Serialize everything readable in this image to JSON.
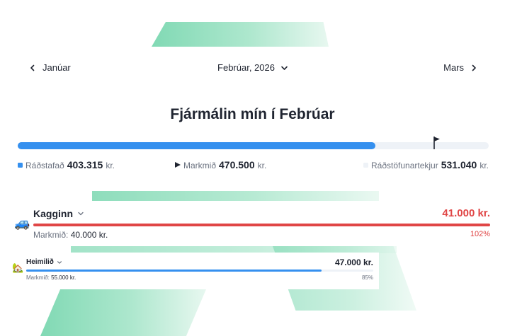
{
  "nav": {
    "prev_label": "Janúar",
    "current_label": "Febrúar, 2026",
    "next_label": "Mars"
  },
  "page_title": "Fjármálin mín í Febrúar",
  "overview": {
    "allocated_fraction": 0.76,
    "allocated": {
      "label": "Ráðstafað",
      "value": "403.315",
      "unit": "kr.",
      "color": "#3590ef"
    },
    "goal": {
      "label": "Markmið",
      "value": "470.500",
      "unit": "kr."
    },
    "income": {
      "label": "Ráðstöfunartekjur",
      "value": "531.040",
      "unit": "kr.",
      "color": "#eef2f7"
    }
  },
  "categories": [
    {
      "name": "Kagginn",
      "icon": "car-icon",
      "amount": "41.000 kr.",
      "goal_label": "Markmið:",
      "goal_value": "40.000 kr.",
      "percent": "102%",
      "fill_fraction": 1.0,
      "color": "#e04646"
    },
    {
      "name": "Heimilið",
      "icon": "house-icon",
      "amount": "47.000 kr.",
      "goal_label": "Markmið:",
      "goal_value": "55.000 kr.",
      "percent": "85%",
      "fill_fraction": 0.85,
      "color": "#3590ef"
    }
  ],
  "colors": {
    "accent_blue": "#3590ef",
    "over_budget_red": "#e04646",
    "deco_green": "#7ad7b0"
  }
}
